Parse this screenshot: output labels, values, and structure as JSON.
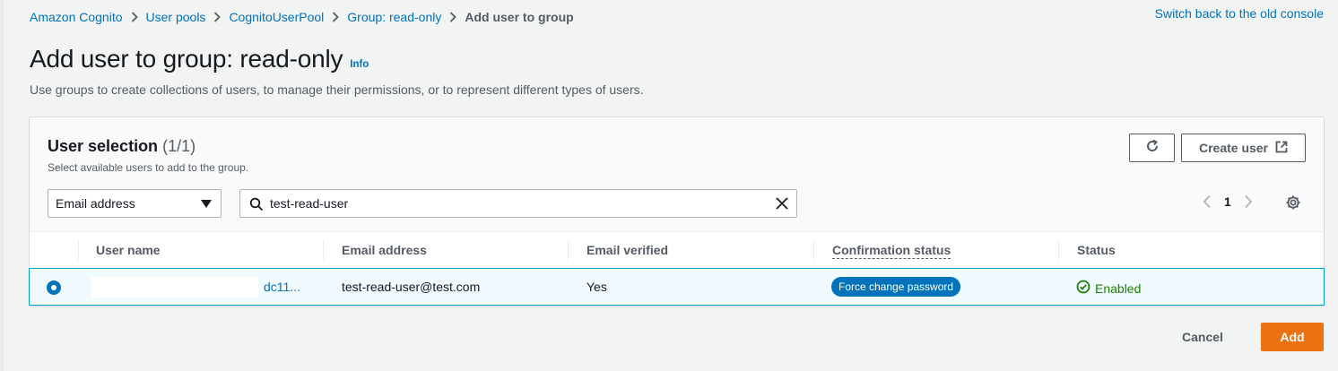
{
  "breadcrumb": {
    "items": [
      "Amazon Cognito",
      "User pools",
      "CognitoUserPool",
      "Group: read-only"
    ],
    "current": "Add user to group"
  },
  "header": {
    "old_console_link": "Switch back to the old console",
    "title": "Add user to group: read-only",
    "info": "Info",
    "description": "Use groups to create collections of users, to manage their permissions, or to represent different types of users."
  },
  "panel": {
    "title": "User selection",
    "count": "(1/1)",
    "subtitle": "Select available users to add to the group.",
    "create_user_label": "Create user",
    "filter_property": "Email address",
    "search_value": "test-read-user",
    "page_number": "1"
  },
  "table": {
    "columns": [
      "User name",
      "Email address",
      "Email verified",
      "Confirmation status",
      "Status"
    ],
    "rows": [
      {
        "user_name": "dc11...",
        "email": "test-read-user@test.com",
        "email_verified": "Yes",
        "confirmation_status": "Force change password",
        "status": "Enabled",
        "selected": true
      }
    ]
  },
  "footer": {
    "cancel_label": "Cancel",
    "add_label": "Add"
  },
  "colors": {
    "link": "#0073bb",
    "primary_button": "#ec7211",
    "badge": "#0073bb",
    "status_enabled": "#1d8102",
    "selected_row_bg": "#f1faff",
    "selected_row_border": "#00a1c9"
  },
  "icons": [
    "chevron-right-icon",
    "refresh-icon",
    "external-link-icon",
    "caret-down-icon",
    "search-icon",
    "close-icon",
    "chevron-left-icon",
    "gear-icon",
    "check-circle-icon"
  ]
}
